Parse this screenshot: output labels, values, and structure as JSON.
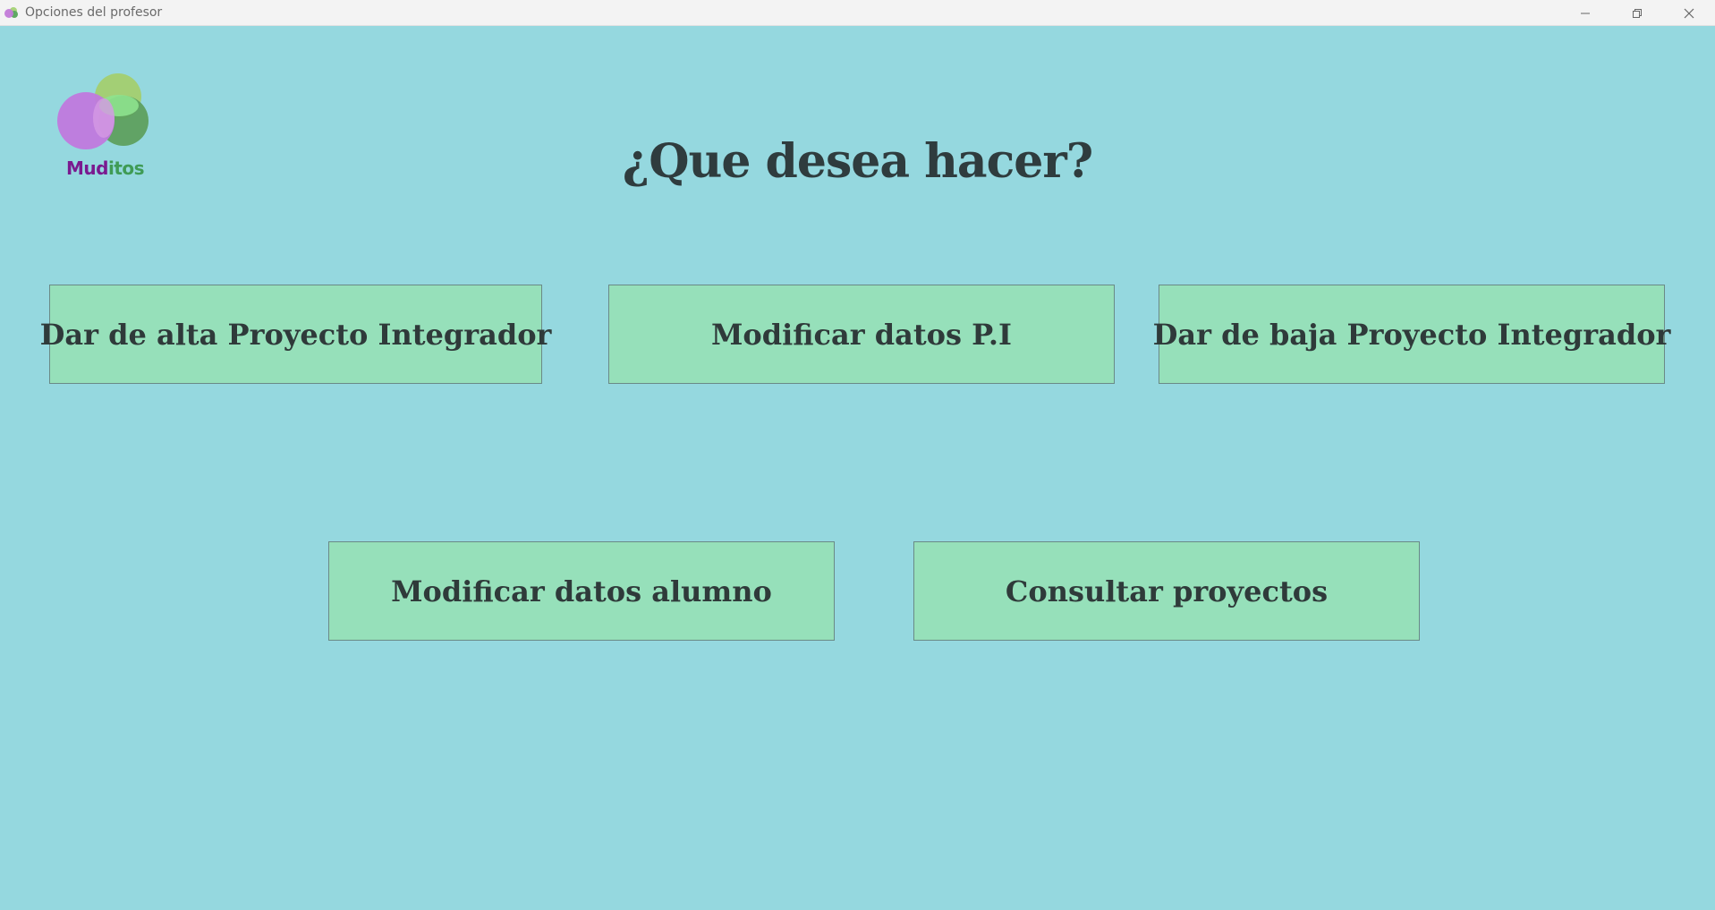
{
  "window": {
    "title": "Opciones del profesor",
    "icon": "app-logo-icon",
    "controls": [
      "minimize-icon",
      "restore-icon",
      "close-icon"
    ]
  },
  "logo": {
    "text_part1": "Mud",
    "text_part2": "itos"
  },
  "heading": "¿Que desea hacer?",
  "buttons": {
    "alta_pi": "Dar de alta Proyecto Integrador",
    "modificar_pi": "Modificar datos P.I",
    "baja_pi": "Dar de baja Proyecto Integrador",
    "modificar_alumno": "Modificar datos alumno",
    "consultar_proyectos": "Consultar proyectos"
  },
  "colors": {
    "background": "#95d8df",
    "button": "#96e0ba",
    "text": "#2f3a3a"
  }
}
